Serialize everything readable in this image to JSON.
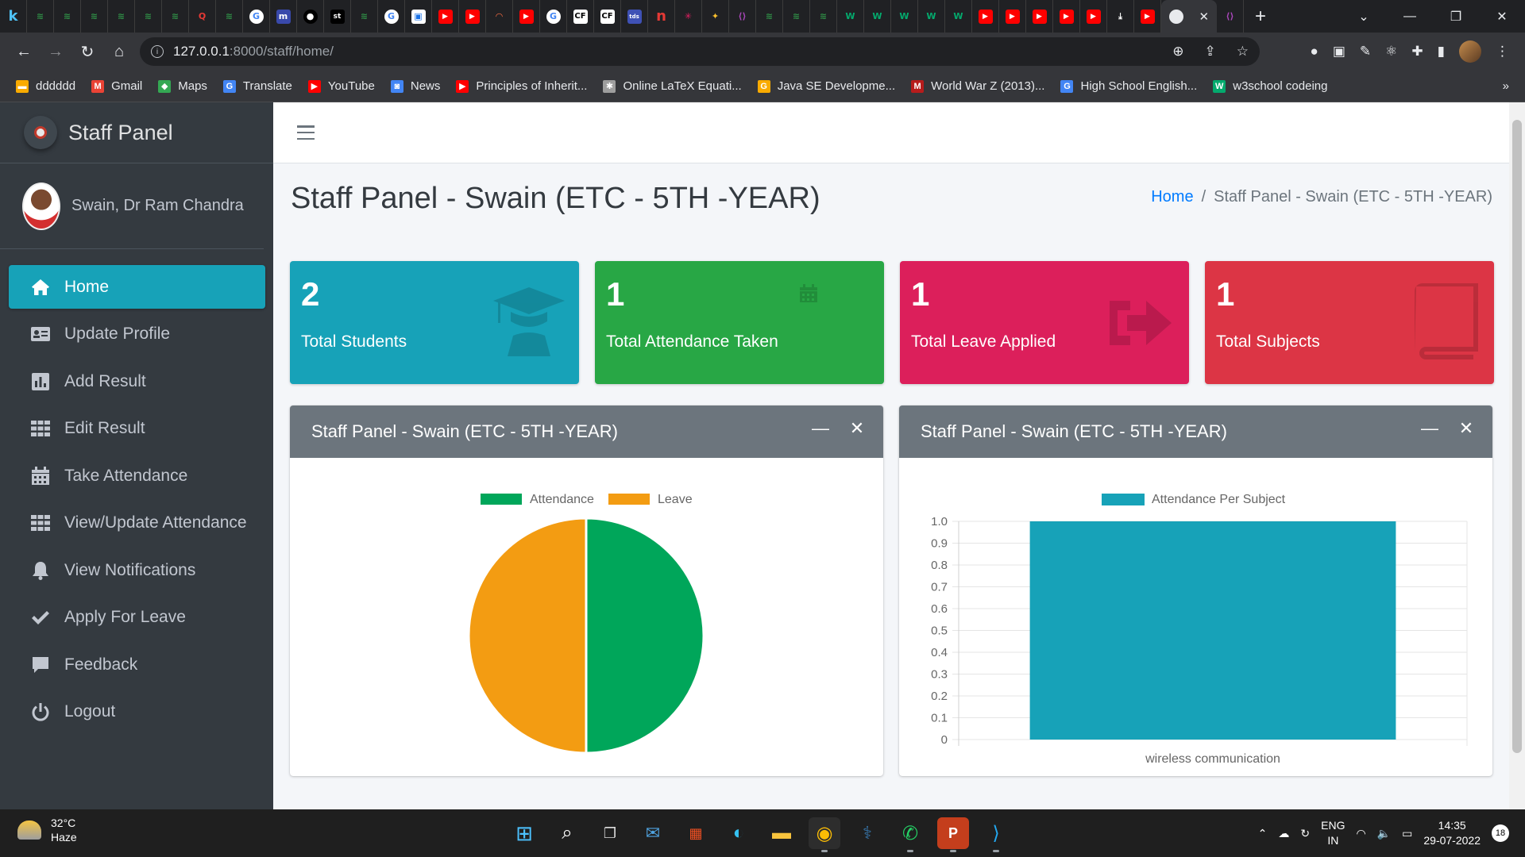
{
  "browser": {
    "url_host": "127.0.0.1",
    "url_path": ":8000/staff/home/",
    "bookmarks": [
      {
        "label": "dddddd",
        "icon": "folder-icon",
        "color": "#f9ab00"
      },
      {
        "label": "Gmail",
        "icon": "gmail-icon",
        "color": "#ea4335"
      },
      {
        "label": "Maps",
        "icon": "maps-icon",
        "color": "#34a853"
      },
      {
        "label": "Translate",
        "icon": "translate-icon",
        "color": "#4285f4"
      },
      {
        "label": "YouTube",
        "icon": "youtube-icon",
        "color": "#ff0000"
      },
      {
        "label": "News",
        "icon": "news-icon",
        "color": "#4285f4"
      },
      {
        "label": "Principles of Inherit...",
        "icon": "youtube-icon",
        "color": "#ff0000"
      },
      {
        "label": "Online LaTeX Equati...",
        "icon": "gear-icon",
        "color": "#9e9e9e"
      },
      {
        "label": "Java SE Developme...",
        "icon": "g-icon",
        "color": "#f9ab00"
      },
      {
        "label": "World War Z (2013)...",
        "icon": "m-icon",
        "color": "#b71c1c"
      },
      {
        "label": "High School English...",
        "icon": "google-icon",
        "color": "#4285f4"
      },
      {
        "label": "w3school codeing",
        "icon": "w-icon",
        "color": "#04aa6d"
      }
    ]
  },
  "sidebar": {
    "brand": "Staff Panel",
    "user_name": "Swain, Dr Ram Chandra",
    "items": [
      {
        "label": "Home",
        "icon": "home-icon",
        "active": true
      },
      {
        "label": "Update Profile",
        "icon": "id-card-icon"
      },
      {
        "label": "Add Result",
        "icon": "chart-icon"
      },
      {
        "label": "Edit Result",
        "icon": "grid-icon"
      },
      {
        "label": "Take Attendance",
        "icon": "calendar-icon"
      },
      {
        "label": "View/Update Attendance",
        "icon": "grid-icon"
      },
      {
        "label": "View Notifications",
        "icon": "bell-icon"
      },
      {
        "label": "Apply For Leave",
        "icon": "check-icon"
      },
      {
        "label": "Feedback",
        "icon": "comment-icon"
      },
      {
        "label": "Logout",
        "icon": "power-icon"
      }
    ]
  },
  "header": {
    "title": "Staff Panel - Swain (ETC - 5TH -YEAR)",
    "breadcrumb_home": "Home",
    "breadcrumb_current": "Staff Panel - Swain (ETC - 5TH -YEAR)"
  },
  "stats": [
    {
      "value": "2",
      "label": "Total Students",
      "color": "#17a2b8",
      "icon": "graduation-cap-icon"
    },
    {
      "value": "1",
      "label": "Total Attendance Taken",
      "color": "#28a745",
      "icon": "calendar-icon"
    },
    {
      "value": "1",
      "label": "Total Leave Applied",
      "color": "#dc1f5b",
      "icon": "sign-out-icon"
    },
    {
      "value": "1",
      "label": "Total Subjects",
      "color": "#dc3545",
      "icon": "book-icon"
    }
  ],
  "cards": [
    {
      "title": "Staff Panel - Swain (ETC - 5TH -YEAR)"
    },
    {
      "title": "Staff Panel - Swain (ETC - 5TH -YEAR)"
    }
  ],
  "chart_data": [
    {
      "type": "pie",
      "labels": [
        "Attendance",
        "Leave"
      ],
      "values": [
        1,
        1
      ],
      "colors": [
        "#00a65a",
        "#f39c12"
      ],
      "legend": "top"
    },
    {
      "type": "bar",
      "categories": [
        "wireless communication"
      ],
      "series": [
        {
          "name": "Attendance Per Subject",
          "values": [
            1
          ],
          "color": "#17a2b8"
        }
      ],
      "ylim": [
        0,
        1.0
      ],
      "yticks": [
        "0",
        "0.1",
        "0.2",
        "0.3",
        "0.4",
        "0.5",
        "0.6",
        "0.7",
        "0.8",
        "0.9",
        "1.0"
      ],
      "grid": true,
      "legend": "top"
    }
  ],
  "taskbar": {
    "temperature": "32°C",
    "weather": "Haze",
    "lang_1": "ENG",
    "lang_2": "IN",
    "time": "14:35",
    "date": "29-07-2022",
    "notification_count": "18"
  }
}
